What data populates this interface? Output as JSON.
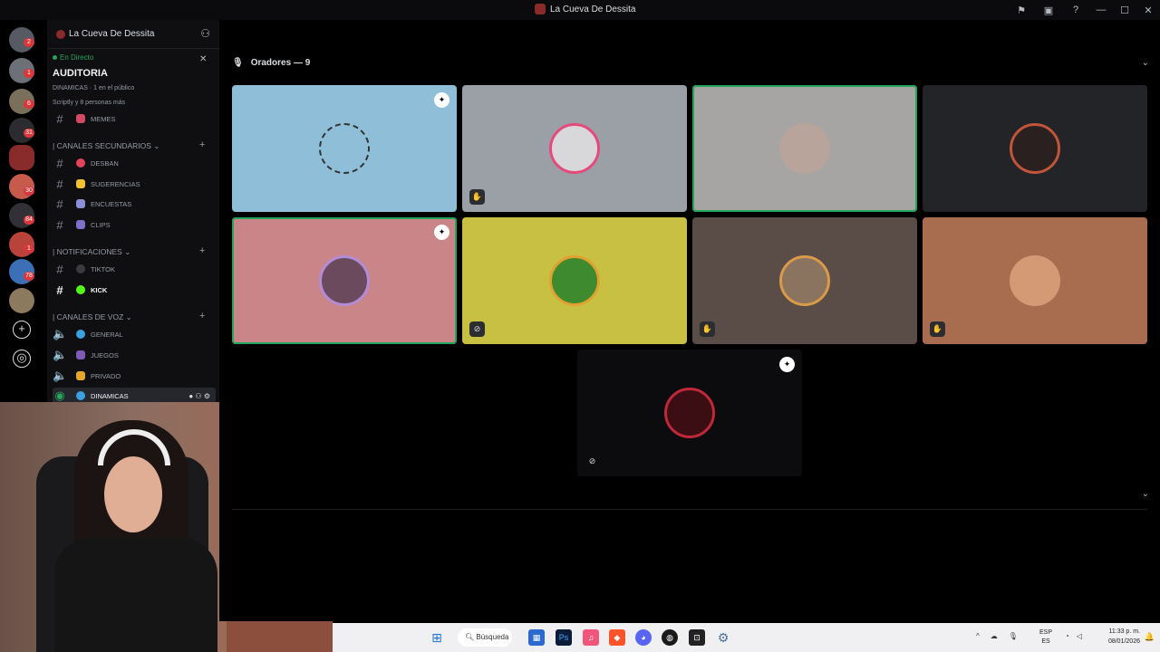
{
  "window": {
    "title": "La Cueva De Dessita"
  },
  "server": {
    "name": "La Cueva De Dessita"
  },
  "stage": {
    "live_label": "En Directo",
    "title": "AUDITORIA",
    "info_line1": "DINAMICAS  ·  1 en el público",
    "info_line2": "Scriptly y 8 personas más"
  },
  "guild_badges": [
    "2",
    "1",
    "6",
    "31",
    "30",
    "84",
    "1",
    "78",
    "1"
  ],
  "channels": {
    "memes": "MEMES",
    "cat_secundarios": "| CANALES SECUNDARIOS",
    "desban": "DESBAN",
    "sugerencias": "SUGERENCIAS",
    "encuestas": "ENCUESTAS",
    "clips": "CLIPS",
    "cat_notificaciones": "| NOTIFICACIONES",
    "tiktok": "TIKTOK",
    "kick": "KICK",
    "cat_voz": "| CANALES DE VOZ",
    "general": "GENERAL",
    "juegos": "JUEGOS",
    "privado": "PRIVADO",
    "dinamicas": "DINAMICAS"
  },
  "speakers": {
    "header": "Oradores — 9"
  },
  "colors": {
    "accent_green": "#23a55a",
    "tile1": "#8fbfd8",
    "tile2": "#9aa0a6",
    "tile3": "#a7a5a3",
    "tile4": "#232428",
    "tile5": "#c98588",
    "tile6": "#c7c043",
    "tile7": "#5a4c46",
    "tile8": "#a86c4f",
    "tile9": "#0c0c0e"
  },
  "taskbar": {
    "search_label": "Búsqueda",
    "tray_lang1": "ESP",
    "tray_lang2": "ES",
    "time": "11:33 p. m.",
    "date": "08/01/2026"
  }
}
